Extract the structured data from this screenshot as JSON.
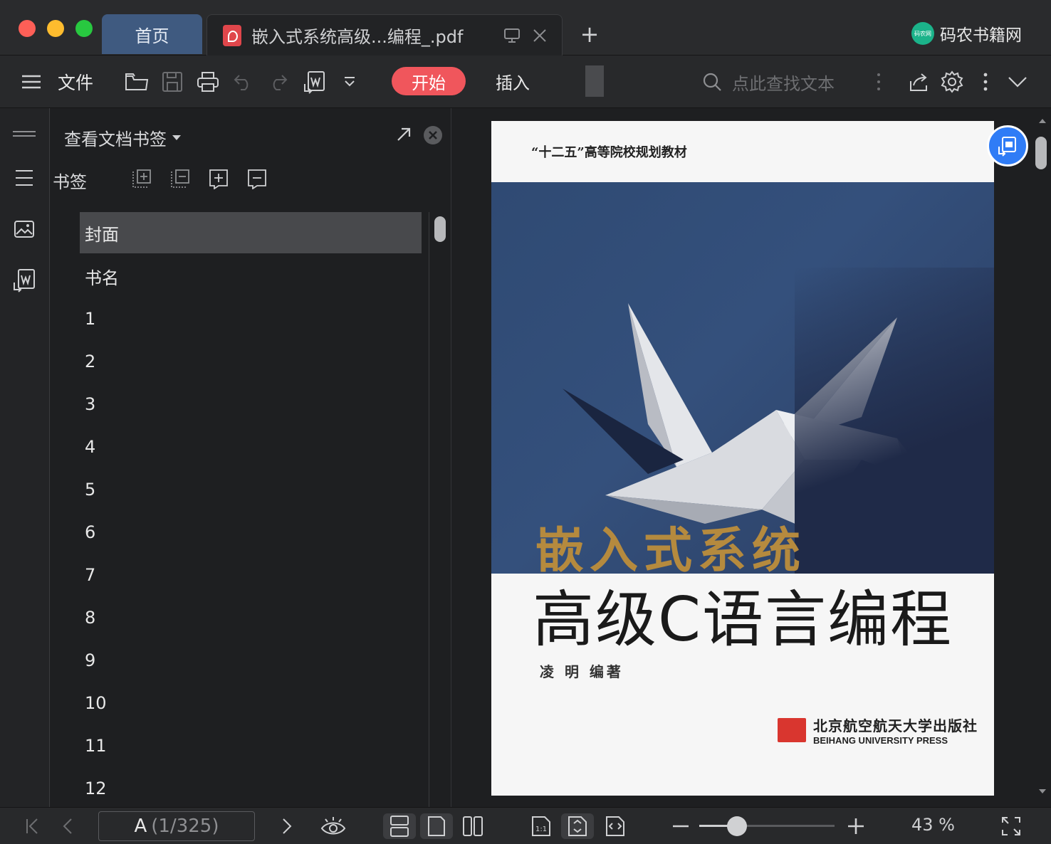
{
  "window": {
    "tabs": [
      {
        "label": "首页"
      },
      {
        "label": "嵌入式系统高级...编程_.pdf"
      }
    ],
    "new_tab": "+",
    "brand": {
      "name": "码农书籍网",
      "logo_text": "码农网"
    }
  },
  "toolbar": {
    "file_label": "文件",
    "start_label": "开始",
    "insert_label": "插入",
    "search_placeholder": "点此查找文本"
  },
  "panel": {
    "title": "查看文档书签",
    "bookmarks_label": "书签",
    "items": [
      {
        "label": "封面"
      },
      {
        "label": "书名"
      },
      {
        "label": "1"
      },
      {
        "label": "2"
      },
      {
        "label": "3"
      },
      {
        "label": "4"
      },
      {
        "label": "5"
      },
      {
        "label": "6"
      },
      {
        "label": "7"
      },
      {
        "label": "8"
      },
      {
        "label": "9"
      },
      {
        "label": "10"
      },
      {
        "label": "11"
      },
      {
        "label": "12"
      }
    ]
  },
  "document": {
    "series": "“十二五”高等院校规划教材",
    "title_cn": "嵌入式系统",
    "title_big": "高级C语言编程",
    "author": "凌  明  编著",
    "publisher_cn": "北京航空航天大学出版社",
    "publisher_en": "BEIHANG UNIVERSITY PRESS"
  },
  "status": {
    "page_label": "A",
    "page_info": "(1/325)",
    "zoom_percent": 43,
    "zoom_text": "43 %"
  },
  "colors": {
    "accent_red": "#f0565c",
    "tab_blue": "#3f5a80",
    "float_blue": "#2f7cf6"
  }
}
